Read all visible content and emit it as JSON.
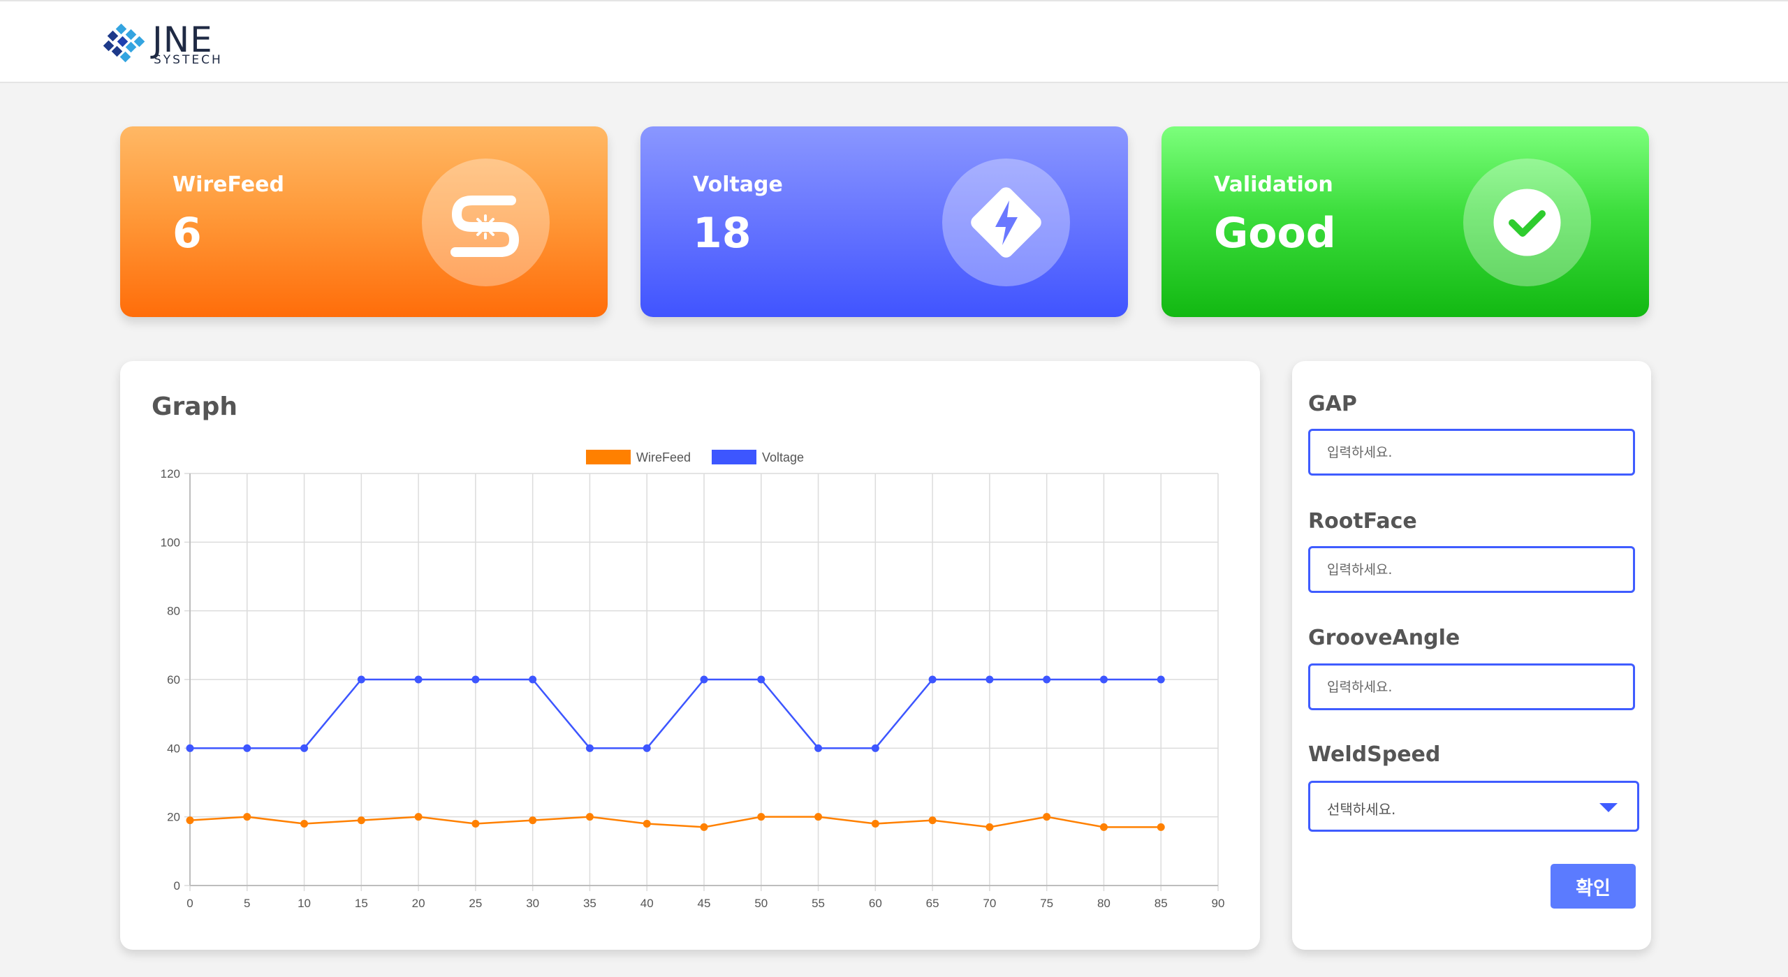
{
  "brand": {
    "name": "JNE",
    "sub": "SYSTECH"
  },
  "cards": [
    {
      "label": "WireFeed",
      "value": "6",
      "icon": "wire-feed-icon"
    },
    {
      "label": "Voltage",
      "value": "18",
      "icon": "lightning-icon"
    },
    {
      "label": "Validation",
      "value": "Good",
      "icon": "check-icon"
    }
  ],
  "graph": {
    "title": "Graph"
  },
  "form": {
    "gap": {
      "label": "GAP",
      "placeholder": "입력하세요."
    },
    "rootface": {
      "label": "RootFace",
      "placeholder": "입력하세요."
    },
    "grooveangle": {
      "label": "GrooveAngle",
      "placeholder": "입력하세요."
    },
    "weldspeed": {
      "label": "WeldSpeed",
      "selected": "선택하세요."
    },
    "confirm_label": "확인"
  },
  "colors": {
    "wirefeed": "#ff8000",
    "voltage": "#3d56ff",
    "accent": "#5b7bff"
  },
  "chart_data": {
    "type": "line",
    "title": "",
    "xlabel": "",
    "ylabel": "",
    "x": [
      0,
      5,
      10,
      15,
      20,
      25,
      30,
      35,
      40,
      45,
      50,
      55,
      60,
      65,
      70,
      75,
      80,
      85
    ],
    "x_ticks": [
      0,
      5,
      10,
      15,
      20,
      25,
      30,
      35,
      40,
      45,
      50,
      55,
      60,
      65,
      70,
      75,
      80,
      85,
      90
    ],
    "y_ticks": [
      0,
      20,
      40,
      60,
      80,
      100,
      120
    ],
    "xlim": [
      0,
      90
    ],
    "ylim": [
      0,
      120
    ],
    "grid": true,
    "legend": "top-center",
    "series": [
      {
        "name": "WireFeed",
        "color": "#ff8000",
        "values": [
          19,
          20,
          18,
          19,
          20,
          18,
          19,
          20,
          18,
          17,
          20,
          20,
          18,
          19,
          17,
          20,
          17,
          17
        ]
      },
      {
        "name": "Voltage",
        "color": "#3d56ff",
        "values": [
          40,
          40,
          40,
          60,
          60,
          60,
          60,
          40,
          40,
          60,
          60,
          40,
          40,
          60,
          60,
          60,
          60,
          60
        ]
      }
    ]
  }
}
